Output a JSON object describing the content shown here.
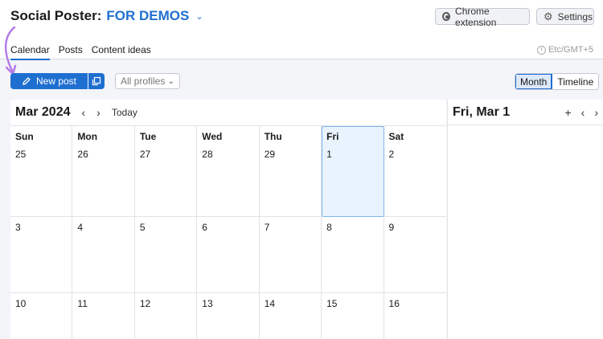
{
  "header": {
    "app_title": "Social Poster:",
    "project_name": "FOR DEMOS",
    "chrome_extension_label": "Chrome extension",
    "settings_label": "Settings"
  },
  "tabs": [
    {
      "label": "Calendar"
    },
    {
      "label": "Posts"
    },
    {
      "label": "Content ideas"
    }
  ],
  "timezone": "Etc/GMT+5",
  "toolbar": {
    "new_post_label": "New post",
    "profiles_value": "All profiles",
    "view_month": "Month",
    "view_timeline": "Timeline"
  },
  "calendar": {
    "month_title": "Mar 2024",
    "today_label": "Today",
    "weekdays": [
      "Sun",
      "Mon",
      "Tue",
      "Wed",
      "Thu",
      "Fri",
      "Sat"
    ],
    "weeks": [
      [
        "25",
        "26",
        "27",
        "28",
        "29",
        "1",
        "2"
      ],
      [
        "3",
        "4",
        "5",
        "6",
        "7",
        "8",
        "9"
      ],
      [
        "10",
        "11",
        "12",
        "13",
        "14",
        "15",
        "16"
      ]
    ]
  },
  "side_panel": {
    "date_title": "Fri, Mar 1"
  },
  "colors": {
    "accent": "#1f6fd1",
    "annotation_arrow": "#b57be8",
    "today_bg": "#e8f3fd"
  }
}
